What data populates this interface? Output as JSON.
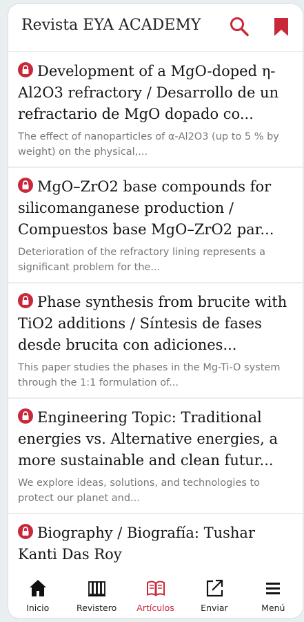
{
  "header": {
    "title": "Revista EYA ACADEMY",
    "search_icon": "search-icon",
    "bookmark_icon": "bookmark-icon"
  },
  "colors": {
    "accent": "#c8283a",
    "text": "#151515",
    "muted": "#777777"
  },
  "articles": [
    {
      "title": "Development of a MgO-doped η-Al2O3 refractory / Desarrollo de un refractario de MgO dopado co...",
      "excerpt": "The effect of nanoparticles of α-Al2O3 (up to 5 % by weight) on the physical,..."
    },
    {
      "title": "MgO–ZrO2 base compounds for silicomanganese production / Compuestos base MgO–ZrO2 par...",
      "excerpt": "Deterioration of the refractory lining represents a significant problem for the..."
    },
    {
      "title": "Phase synthesis from brucite with TiO2 additions / Síntesis de fases desde brucita con adiciones...",
      "excerpt": "This paper studies the phases in the Mg-Ti-O system through the 1:1 formulation of..."
    },
    {
      "title": "Engineering Topic: Traditional energies vs. Alternative energies, a more sustainable and clean futur...",
      "excerpt": "We explore ideas, solutions, and technologies to protect our planet and..."
    },
    {
      "title": "Biography / Biografía: Tushar Kanti Das Roy",
      "excerpt": ""
    }
  ],
  "tabs": [
    {
      "label": "Inicio",
      "icon": "home-icon"
    },
    {
      "label": "Revistero",
      "icon": "magazine-rack-icon"
    },
    {
      "label": "Artículos",
      "icon": "open-book-icon",
      "active": true
    },
    {
      "label": "Enviar",
      "icon": "share-icon"
    },
    {
      "label": "Menú",
      "icon": "menu-icon"
    }
  ]
}
